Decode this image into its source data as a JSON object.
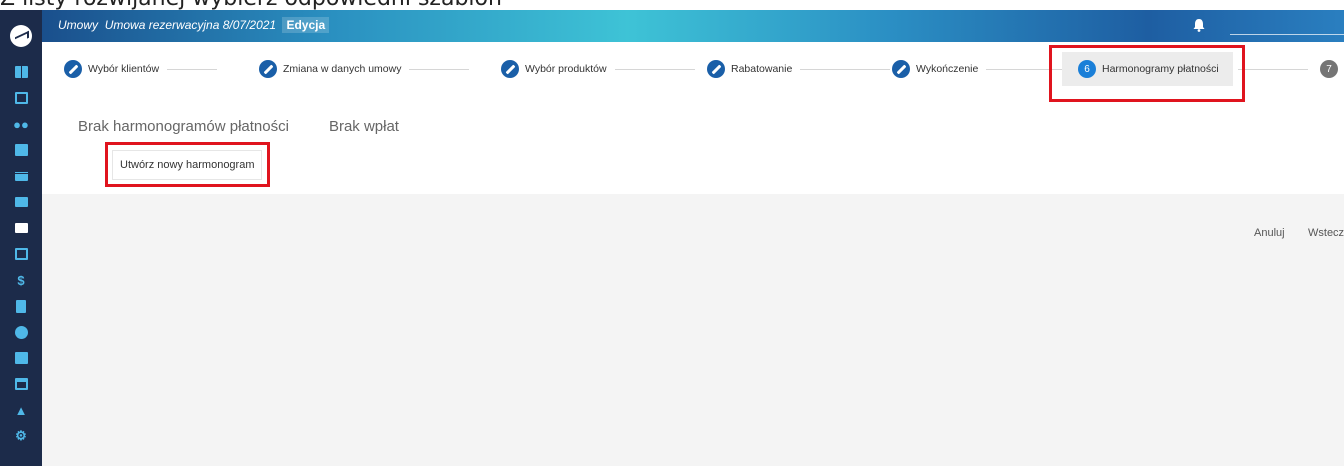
{
  "caption": "Z listy rozwijanej wybierz odpowiedni szablon",
  "header": {
    "module": "Umowy",
    "record": "Umowa rezerwacyjna 8/07/2021",
    "mode": "Edycja"
  },
  "sidebar": {
    "icons": [
      "dashboard-icon",
      "calendar-icon",
      "users-icon",
      "building-icon",
      "store-icon",
      "briefcase-icon",
      "folder-icon",
      "inbox-icon",
      "dollar-icon",
      "document-icon",
      "pie-chart-icon",
      "bar-chart-icon",
      "card-icon",
      "warning-icon",
      "gear-icon"
    ],
    "active": "folder-icon"
  },
  "stepper": {
    "steps": [
      {
        "label": "Wybór klientów",
        "state": "done"
      },
      {
        "label": "Zmiana w danych umowy",
        "state": "done"
      },
      {
        "label": "Wybór produktów",
        "state": "done"
      },
      {
        "label": "Rabatowanie",
        "state": "done"
      },
      {
        "label": "Wykończenie",
        "state": "done"
      },
      {
        "label": "Harmonogramy płatności",
        "state": "current",
        "number": "6"
      },
      {
        "label": "",
        "state": "future",
        "number": "7"
      }
    ]
  },
  "tabs": [
    "Brak harmonogramów płatności",
    "Brak wpłat"
  ],
  "create_button": "Utwórz nowy harmonogram",
  "actions": {
    "cancel": "Anuluj",
    "back": "Wstecz"
  },
  "colors": {
    "sidebar": "#1c2b4a",
    "accent": "#1a5fa8",
    "highlight": "#e0141e",
    "sidebar_icon": "#4fb8e8"
  }
}
